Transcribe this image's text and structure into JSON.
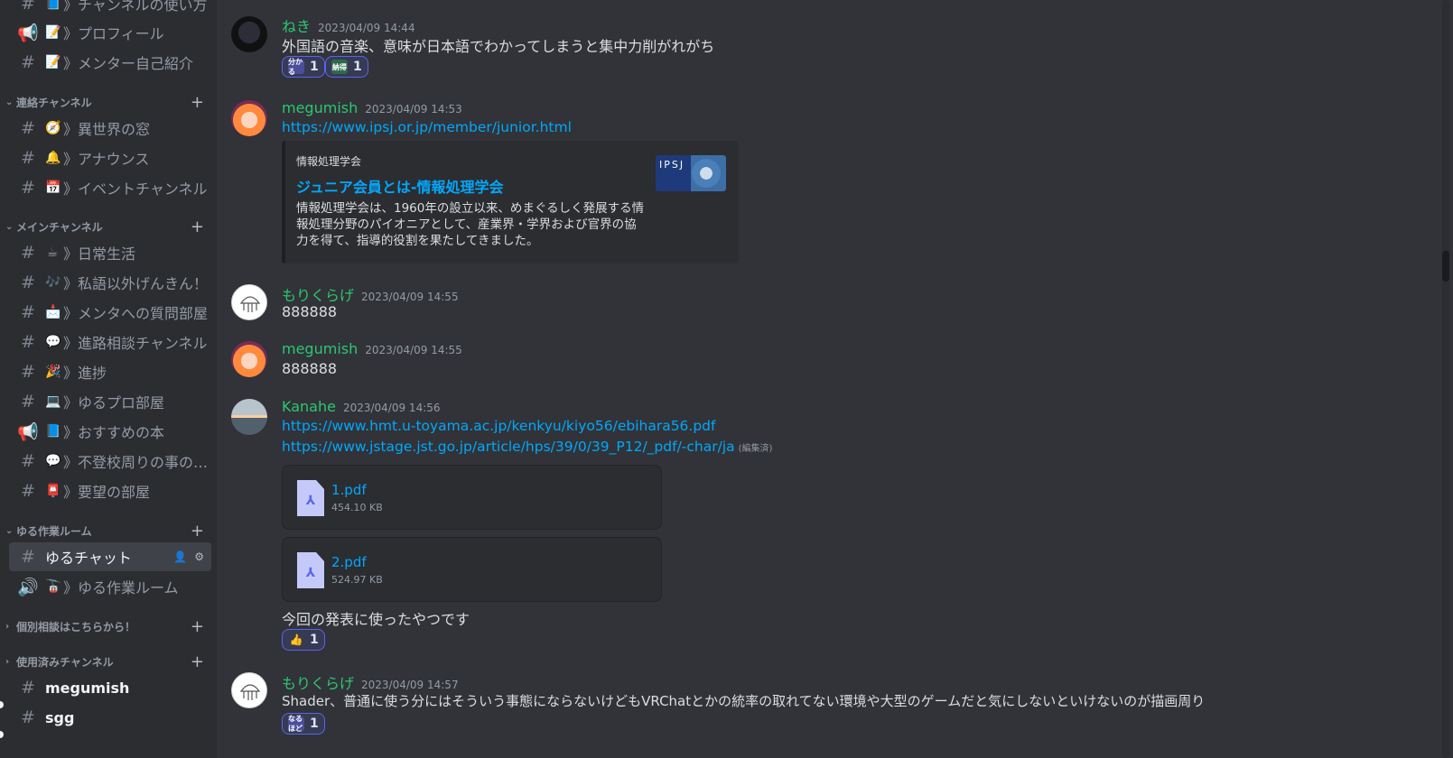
{
  "sidebar": {
    "channels_top": [
      {
        "prefix": "#",
        "emoji": "📘",
        "label": "》チャンネルの使い方"
      },
      {
        "prefix": "📢",
        "emoji": "📝",
        "label": "》プロフィール"
      },
      {
        "prefix": "#",
        "emoji": "📝",
        "label": "》メンター自己紹介"
      }
    ],
    "categories": [
      {
        "name": "連絡チャンネル"
      },
      {
        "name": "メインチャンネル"
      },
      {
        "name": "ゆる作業ルーム"
      },
      {
        "name": "個別相談はこちらから！"
      },
      {
        "name": "使用済みチャンネル"
      }
    ],
    "channels_contact": [
      {
        "prefix": "#",
        "emoji": "🧭",
        "label": "》異世界の窓"
      },
      {
        "prefix": "#",
        "emoji": "🔔",
        "label": "》アナウンス"
      },
      {
        "prefix": "#",
        "emoji": "📅",
        "label": "》イベントチャンネル"
      }
    ],
    "channels_main": [
      {
        "prefix": "#",
        "emoji": "☕",
        "label": "》日常生活"
      },
      {
        "prefix": "#",
        "emoji": "🎶",
        "label": "》私語以外げんきん！"
      },
      {
        "prefix": "#",
        "emoji": "📩",
        "label": "》メンタへの質問部屋"
      },
      {
        "prefix": "#",
        "emoji": "💬",
        "label": "》進路相談チャンネル"
      },
      {
        "prefix": "#",
        "emoji": "🎉",
        "label": "》進捗"
      },
      {
        "prefix": "#",
        "emoji": "💻",
        "label": "》ゆるプロ部屋"
      },
      {
        "prefix": "📢",
        "emoji": "📘",
        "label": "》おすすめの本"
      },
      {
        "prefix": "#",
        "emoji": "💬",
        "label": "》不登校周りの事の…"
      },
      {
        "prefix": "#",
        "emoji": "📮",
        "label": "》要望の部屋"
      }
    ],
    "channels_work": [
      {
        "prefix": "#",
        "emoji": "",
        "label": "ゆるチャット"
      },
      {
        "prefix": "🔊",
        "emoji": "🚡",
        "label": "》ゆる作業ルーム"
      }
    ],
    "channels_used": [
      {
        "prefix": "#",
        "label": "megumish"
      },
      {
        "prefix": "#",
        "label": "sgg"
      }
    ],
    "icons": {
      "add_member": "👤",
      "settings": "⚙",
      "plus": "+",
      "chevron": "›"
    }
  },
  "messages": [
    {
      "author": "ねき",
      "timestamp": "2023/04/09 14:44",
      "text": "外国語の音楽、意味が日本語でわかってしまうと集中力削がれがち",
      "reactions": [
        {
          "emoji": "分かる",
          "count": "1"
        },
        {
          "emoji": "納得",
          "count": "1"
        }
      ]
    },
    {
      "author": "megumish",
      "timestamp": "2023/04/09 14:53",
      "link": "https://www.ipsj.or.jp/member/junior.html",
      "embed": {
        "provider": "情報処理学会",
        "title": "ジュニア会員とは-情報処理学会",
        "description": "情報処理学会は、1960年の設立以来、めまぐるしく発展する情報処理分野のパイオニアとして、産業界・学界および官界の協力を得て、指導的役割を果たしてきました。",
        "thumb_label": "IPSJ"
      }
    },
    {
      "author": "もりくらげ",
      "timestamp": "2023/04/09 14:55",
      "text": "888888"
    },
    {
      "author": "megumish",
      "timestamp": "2023/04/09 14:55",
      "text": "888888"
    },
    {
      "author": "Kanahe",
      "timestamp": "2023/04/09 14:56",
      "link1": "https://www.hmt.u-toyama.ac.jp/kenkyu/kiyo56/ebihara56.pdf",
      "link2": "https://www.jstage.jst.go.jp/article/hps/39/0/39_P12/_pdf/-char/ja",
      "edited": "(編集済)",
      "files": [
        {
          "name": "1.pdf",
          "size": "454.10 KB"
        },
        {
          "name": "2.pdf",
          "size": "524.97 KB"
        }
      ],
      "text": "今回の発表に使ったやつです",
      "reactions": [
        {
          "emoji": "👍",
          "count": "1"
        }
      ]
    },
    {
      "author": "もりくらげ",
      "timestamp": "2023/04/09 14:57",
      "text": "Shader、普通に使う分にはそういう事態にならないけどもVRChatとかの統率の取れてない環境や大型のゲームだと気にしないといけないのが描画周り",
      "reactions": [
        {
          "emoji": "なるほど",
          "count": "1"
        }
      ]
    }
  ],
  "colors": {
    "accent": "#5865f2",
    "username": "#2dc770",
    "link": "#00a8fc"
  }
}
